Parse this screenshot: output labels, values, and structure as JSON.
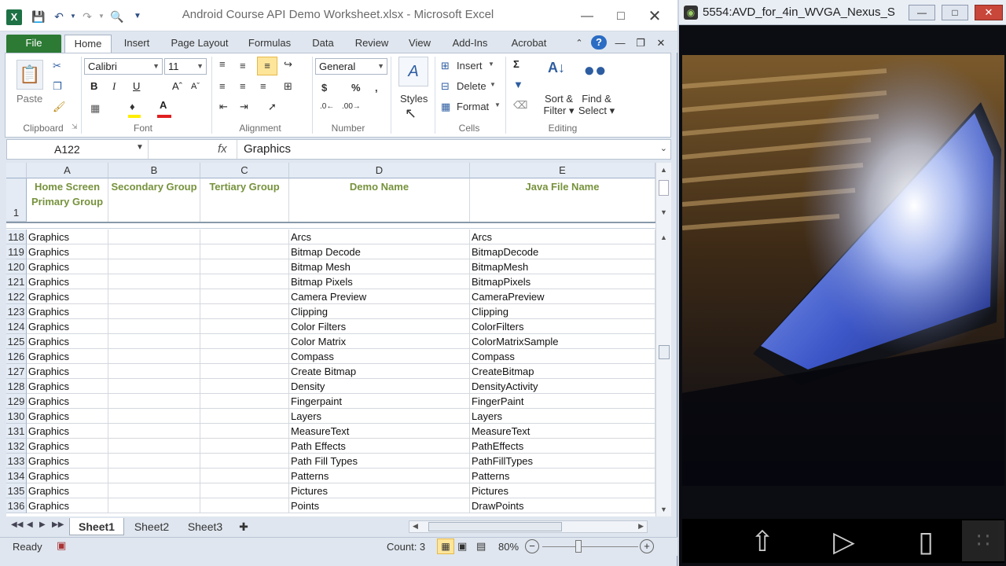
{
  "excel": {
    "title": "Android Course API Demo Worksheet.xlsx  -  Microsoft Excel",
    "tabs": [
      "File",
      "Home",
      "Insert",
      "Page Layout",
      "Formulas",
      "Data",
      "Review",
      "View",
      "Add-Ins",
      "Acrobat"
    ],
    "ribbon": {
      "clipboard": {
        "label": "Clipboard",
        "paste": "Paste"
      },
      "font": {
        "label": "Font",
        "name": "Calibri",
        "size": "11"
      },
      "alignment": {
        "label": "Alignment"
      },
      "number": {
        "label": "Number",
        "format": "General"
      },
      "styles": {
        "label": "Styles"
      },
      "cells": {
        "label": "Cells",
        "insert": "Insert",
        "delete": "Delete",
        "format": "Format"
      },
      "editing": {
        "label": "Editing",
        "sort1": "Sort &",
        "sort2": "Filter",
        "find1": "Find &",
        "find2": "Select"
      }
    },
    "namebox": "A122",
    "fx": "fx",
    "formula": "Graphics",
    "columns": [
      "A",
      "B",
      "C",
      "D",
      "E"
    ],
    "header_row": {
      "num": "1",
      "a": "Home Screen Primary Group",
      "b": "Secondary Group",
      "c": "Tertiary Group",
      "d": "Demo Name",
      "e": "Java File Name"
    },
    "rows": [
      {
        "num": "118",
        "a": "Graphics",
        "d": "Arcs",
        "e": "Arcs"
      },
      {
        "num": "119",
        "a": "Graphics",
        "d": "Bitmap Decode",
        "e": "BitmapDecode"
      },
      {
        "num": "120",
        "a": "Graphics",
        "d": "Bitmap Mesh",
        "e": "BitmapMesh"
      },
      {
        "num": "121",
        "a": "Graphics",
        "d": "Bitmap Pixels",
        "e": "BitmapPixels"
      },
      {
        "num": "122",
        "a": "Graphics",
        "d": "Camera Preview",
        "e": "CameraPreview"
      },
      {
        "num": "123",
        "a": "Graphics",
        "d": "Clipping",
        "e": "Clipping"
      },
      {
        "num": "124",
        "a": "Graphics",
        "d": "Color Filters",
        "e": "ColorFilters"
      },
      {
        "num": "125",
        "a": "Graphics",
        "d": "Color Matrix",
        "e": "ColorMatrixSample"
      },
      {
        "num": "126",
        "a": "Graphics",
        "d": "Compass",
        "e": "Compass"
      },
      {
        "num": "127",
        "a": "Graphics",
        "d": "Create Bitmap",
        "e": "CreateBitmap"
      },
      {
        "num": "128",
        "a": "Graphics",
        "d": "Density",
        "e": "DensityActivity"
      },
      {
        "num": "129",
        "a": "Graphics",
        "d": "Fingerpaint",
        "e": "FingerPaint"
      },
      {
        "num": "130",
        "a": "Graphics",
        "d": "Layers",
        "e": "Layers"
      },
      {
        "num": "131",
        "a": "Graphics",
        "d": "MeasureText",
        "e": "MeasureText"
      },
      {
        "num": "132",
        "a": "Graphics",
        "d": "Path Effects",
        "e": "PathEffects"
      },
      {
        "num": "133",
        "a": "Graphics",
        "d": "Path Fill Types",
        "e": "PathFillTypes"
      },
      {
        "num": "134",
        "a": "Graphics",
        "d": "Patterns",
        "e": "Patterns"
      },
      {
        "num": "135",
        "a": "Graphics",
        "d": "Pictures",
        "e": "Pictures"
      },
      {
        "num": "136",
        "a": "Graphics",
        "d": "Points",
        "e": "DrawPoints"
      }
    ],
    "sheets": [
      "Sheet1",
      "Sheet2",
      "Sheet3"
    ],
    "status": {
      "ready": "Ready",
      "count": "Count: 3",
      "zoom": "80%"
    }
  },
  "avd": {
    "title": "5554:AVD_for_4in_WVGA_Nexus_S"
  },
  "colors": {
    "header_text": "#76923c",
    "file_tab": "#2c7a34",
    "font_color_bar": "#e02020",
    "highlight_bar": "#ffee00"
  }
}
